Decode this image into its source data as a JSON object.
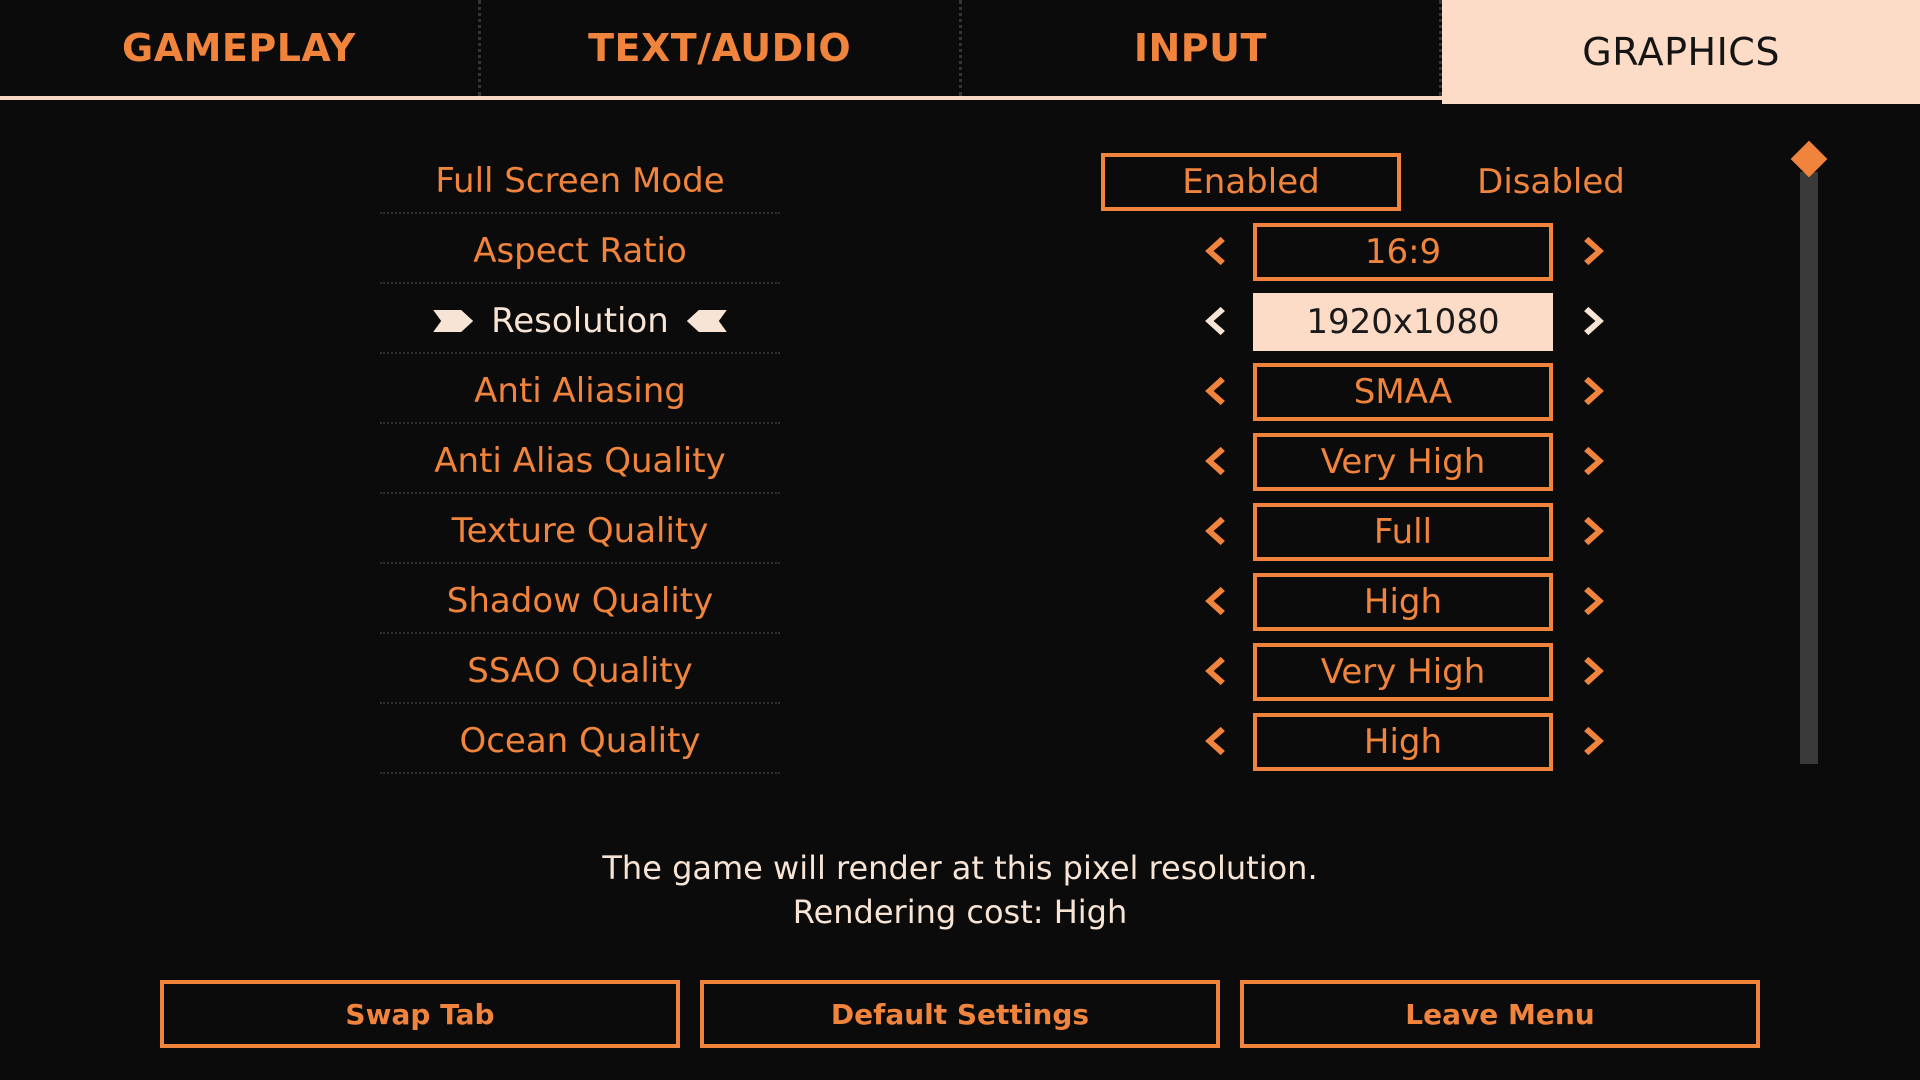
{
  "tabs": [
    {
      "label": "GAMEPLAY",
      "active": false
    },
    {
      "label": "TEXT/AUDIO",
      "active": false
    },
    {
      "label": "INPUT",
      "active": false
    },
    {
      "label": "GRAPHICS",
      "active": true
    }
  ],
  "full_screen": {
    "label": "Full Screen Mode",
    "enabled_label": "Enabled",
    "disabled_label": "Disabled",
    "selected": "Enabled"
  },
  "settings": [
    {
      "label": "Aspect Ratio",
      "value": "16:9"
    },
    {
      "label": "Resolution",
      "value": "1920x1080",
      "selected": true
    },
    {
      "label": "Anti Aliasing",
      "value": "SMAA"
    },
    {
      "label": "Anti Alias Quality",
      "value": "Very High"
    },
    {
      "label": "Texture Quality",
      "value": "Full"
    },
    {
      "label": "Shadow Quality",
      "value": "High"
    },
    {
      "label": "SSAO Quality",
      "value": "Very High"
    },
    {
      "label": "Ocean Quality",
      "value": "High"
    }
  ],
  "description": {
    "line1": "The game will render at this pixel resolution.",
    "line2": "Rendering cost: High"
  },
  "buttons": {
    "swap_tab": "Swap Tab",
    "default_settings": "Default Settings",
    "leave_menu": "Leave Menu"
  },
  "colors": {
    "accent": "#f0843c",
    "highlight": "#fcdcc6",
    "background": "#0b0b0b"
  },
  "icons": {
    "left_arrow": "chevron-left-icon",
    "right_arrow": "chevron-right-icon",
    "selection_marker": "pointer-marker-icon",
    "scroll_thumb": "diamond-icon"
  }
}
